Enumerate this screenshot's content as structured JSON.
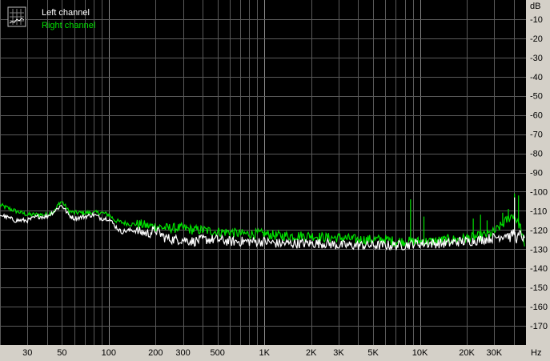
{
  "chart_data": {
    "type": "line",
    "title": "",
    "xlabel": "",
    "ylabel": "",
    "x_unit": "Hz",
    "y_unit": "dB",
    "x_scale": "log",
    "xlim": [
      20,
      48000
    ],
    "ylim": [
      -180,
      0
    ],
    "grid": true,
    "legend_placement": "top-left",
    "background_color": "#000000",
    "x_ticks": [
      {
        "value": 30,
        "label": "30"
      },
      {
        "value": 50,
        "label": "50"
      },
      {
        "value": 100,
        "label": "100"
      },
      {
        "value": 200,
        "label": "200"
      },
      {
        "value": 300,
        "label": "300"
      },
      {
        "value": 500,
        "label": "500"
      },
      {
        "value": 1000,
        "label": "1K"
      },
      {
        "value": 2000,
        "label": "2K"
      },
      {
        "value": 3000,
        "label": "3K"
      },
      {
        "value": 5000,
        "label": "5K"
      },
      {
        "value": 10000,
        "label": "10K"
      },
      {
        "value": 20000,
        "label": "20K"
      },
      {
        "value": 30000,
        "label": "30K"
      }
    ],
    "y_ticks": [
      {
        "value": -10,
        "label": "-10"
      },
      {
        "value": -20,
        "label": "-20"
      },
      {
        "value": -30,
        "label": "-30"
      },
      {
        "value": -40,
        "label": "-40"
      },
      {
        "value": -50,
        "label": "-50"
      },
      {
        "value": -60,
        "label": "-60"
      },
      {
        "value": -70,
        "label": "-70"
      },
      {
        "value": -80,
        "label": "-80"
      },
      {
        "value": -90,
        "label": "-90"
      },
      {
        "value": -100,
        "label": "-100"
      },
      {
        "value": -110,
        "label": "-110"
      },
      {
        "value": -120,
        "label": "-120"
      },
      {
        "value": -130,
        "label": "-130"
      },
      {
        "value": -140,
        "label": "-140"
      },
      {
        "value": -150,
        "label": "-150"
      },
      {
        "value": -160,
        "label": "-160"
      },
      {
        "value": -170,
        "label": "-170"
      }
    ],
    "series": [
      {
        "name": "Left channel",
        "color": "#ffffff",
        "x": [
          20,
          25,
          30,
          35,
          40,
          45,
          48,
          50,
          55,
          60,
          70,
          80,
          90,
          100,
          110,
          120,
          140,
          160,
          180,
          200,
          230,
          260,
          300,
          350,
          400,
          500,
          600,
          700,
          800,
          1000,
          1200,
          1500,
          2000,
          2500,
          3000,
          4000,
          5000,
          6000,
          7000,
          8000,
          9000,
          10000,
          12000,
          15000,
          18000,
          20000,
          25000,
          30000,
          34000,
          36000,
          38000,
          40000,
          42000,
          44000,
          46000,
          47000
        ],
        "y": [
          -112,
          -115,
          -115,
          -113,
          -113,
          -110,
          -108,
          -107,
          -112,
          -114,
          -113,
          -112,
          -114,
          -114,
          -118,
          -121,
          -120,
          -121,
          -122,
          -120,
          -124,
          -125,
          -125,
          -126,
          -125,
          -125,
          -126,
          -126,
          -126,
          -126,
          -127,
          -127,
          -127,
          -127,
          -128,
          -128,
          -128,
          -128,
          -128,
          -128,
          -127,
          -127,
          -127,
          -127,
          -126,
          -126,
          -125,
          -124,
          -123,
          -122,
          -124,
          -121,
          -125,
          -122,
          -124,
          -126
        ]
      },
      {
        "name": "Right channel",
        "color": "#00e000",
        "x": [
          20,
          25,
          30,
          35,
          40,
          45,
          48,
          50,
          55,
          60,
          70,
          80,
          90,
          100,
          110,
          120,
          140,
          160,
          180,
          200,
          230,
          260,
          300,
          350,
          400,
          500,
          600,
          700,
          800,
          1000,
          1200,
          1500,
          2000,
          2500,
          3000,
          4000,
          5000,
          6000,
          7000,
          8000,
          8500,
          9000,
          10000,
          12000,
          15000,
          18000,
          20000,
          22000,
          25000,
          28000,
          30000,
          32000,
          34000,
          36000,
          38000,
          40000,
          42000,
          44000,
          46000,
          47000
        ],
        "y": [
          -107,
          -110,
          -112,
          -112,
          -112,
          -110,
          -106,
          -105,
          -110,
          -111,
          -111,
          -111,
          -111,
          -112,
          -115,
          -116,
          -117,
          -117,
          -118,
          -118,
          -119,
          -119,
          -119,
          -120,
          -120,
          -121,
          -121,
          -122,
          -122,
          -122,
          -123,
          -123,
          -123,
          -124,
          -124,
          -125,
          -125,
          -125,
          -126,
          -126,
          -126,
          -126,
          -126,
          -126,
          -125,
          -125,
          -124,
          -124,
          -123,
          -122,
          -121,
          -119,
          -117,
          -115,
          -113,
          -112,
          -115,
          -118,
          -125,
          -130
        ]
      }
    ],
    "spikes": [
      {
        "series": "Right channel",
        "x": 8700,
        "y": -104
      },
      {
        "series": "Right channel",
        "x": 10600,
        "y": -113
      },
      {
        "series": "Right channel",
        "x": 22000,
        "y": -114
      },
      {
        "series": "Right channel",
        "x": 24500,
        "y": -112
      },
      {
        "series": "Right channel",
        "x": 27000,
        "y": -115
      },
      {
        "series": "Right channel",
        "x": 34000,
        "y": -111
      },
      {
        "series": "Right channel",
        "x": 37000,
        "y": -109
      },
      {
        "series": "Right channel",
        "x": 40500,
        "y": -101
      },
      {
        "series": "Right channel",
        "x": 43000,
        "y": -102
      },
      {
        "series": "Left channel",
        "x": 40500,
        "y": -103
      }
    ]
  }
}
